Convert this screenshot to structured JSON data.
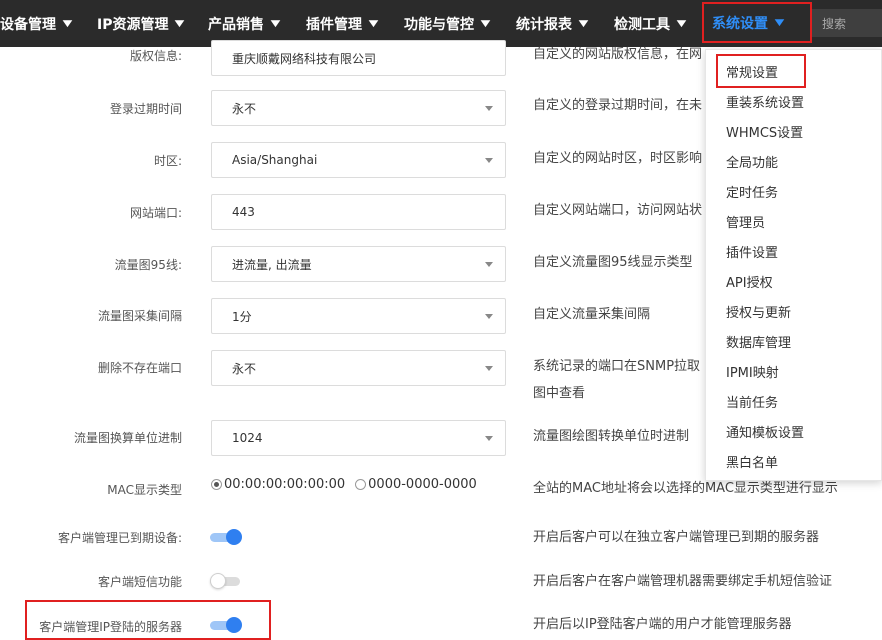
{
  "nav": {
    "items": [
      {
        "label": "设备管理"
      },
      {
        "label": "IP资源管理"
      },
      {
        "label": "产品销售"
      },
      {
        "label": "插件管理"
      },
      {
        "label": "功能与管控"
      },
      {
        "label": "统计报表"
      },
      {
        "label": "检测工具"
      },
      {
        "label": "系统设置"
      }
    ],
    "search_placeholder": "搜索"
  },
  "form": {
    "rows": [
      {
        "label": "版权信息:",
        "value": "重庆顺戴网络科技有限公司",
        "desc": "自定义的网站版权信息，在网"
      },
      {
        "label": "登录过期时间",
        "value": "永不",
        "desc": "自定义的登录过期时间，在未"
      },
      {
        "label": "时区:",
        "value": "Asia/Shanghai",
        "desc": "自定义的网站时区，时区影响"
      },
      {
        "label": "网站端口:",
        "value": "443",
        "desc": "自定义网站端口，访问网站状"
      },
      {
        "label": "流量图95线:",
        "value": "进流量, 出流量",
        "desc": "自定义流量图95线显示类型"
      },
      {
        "label": "流量图采集间隔",
        "value": "1分",
        "desc": "自定义流量采集间隔"
      },
      {
        "label": "删除不存在端口",
        "value": "永不",
        "desc": "系统记录的端口在SNMP拉取",
        "desc2": "图中查看"
      },
      {
        "label": "流量图换算单位进制",
        "value": "1024",
        "desc": "流量图绘图转换单位时进制"
      }
    ],
    "mac": {
      "label": "MAC显示类型",
      "options": [
        "00:00:00:00:00:00",
        "0000-0000-0000"
      ],
      "selected": "00:00:00:00:00:00",
      "desc": "全站的MAC地址将会以选择的MAC显示类型进行显示"
    },
    "switches": [
      {
        "label": "客户端管理已到期设备:",
        "on": true,
        "desc": "开启后客户可以在独立客户端管理已到期的服务器"
      },
      {
        "label": "客户端短信功能",
        "on": false,
        "desc": "开启后客户在客户端管理机器需要绑定手机短信验证"
      },
      {
        "label": "客户端管理IP登陆的服务器",
        "on": true,
        "desc": "开启后以IP登陆客户端的用户才能管理服务器"
      }
    ]
  },
  "dropdown": {
    "items": [
      "常规设置",
      "重装系统设置",
      "WHMCS设置",
      "全局功能",
      "定时任务",
      "管理员",
      "插件设置",
      "API授权",
      "授权与更新",
      "数据库管理",
      "IPMI映射",
      "当前任务",
      "通知模板设置",
      "黑白名单"
    ]
  },
  "colors": {
    "nav_bg": "#2b2b2b",
    "accent": "#2f8ef7",
    "highlight": "#e02020"
  }
}
